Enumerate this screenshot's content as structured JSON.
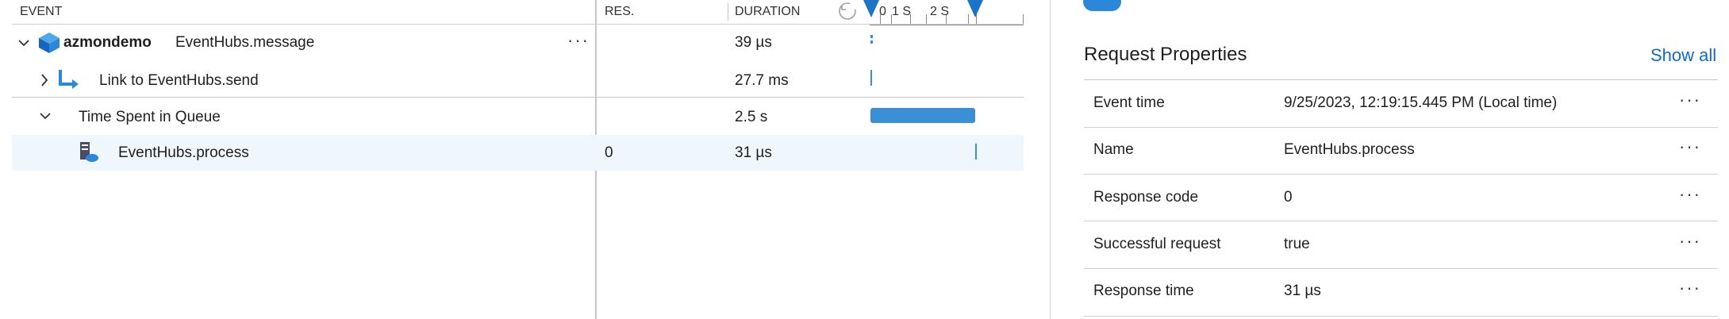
{
  "table": {
    "headers": {
      "event": "EVENT",
      "res": "RES.",
      "duration": "DURATION"
    },
    "timeline_ticks": [
      "0",
      "1 S",
      "2 S"
    ],
    "rows": [
      {
        "name": "azmondemo",
        "detail": "EventHubs.message",
        "res": "",
        "duration": "39 µs"
      },
      {
        "name": "Link to EventHubs.send",
        "res": "",
        "duration": "27.7 ms"
      },
      {
        "name": "Time Spent in Queue",
        "res": "",
        "duration": "2.5 s"
      },
      {
        "name": "EventHubs.process",
        "res": "0",
        "duration": "31 µs"
      }
    ]
  },
  "panel": {
    "title": "Request Properties",
    "show_all": "Show all",
    "properties": [
      {
        "label": "Event time",
        "value": "9/25/2023, 12:19:15.445 PM (Local time)"
      },
      {
        "label": "Name",
        "value": "EventHubs.process"
      },
      {
        "label": "Response code",
        "value": "0"
      },
      {
        "label": "Successful request",
        "value": "true"
      },
      {
        "label": "Response time",
        "value": "31 µs"
      }
    ]
  },
  "colors": {
    "accent": "#0f6cbd",
    "bar": "#3a8fd6",
    "selected_row": "#eff6fc"
  }
}
